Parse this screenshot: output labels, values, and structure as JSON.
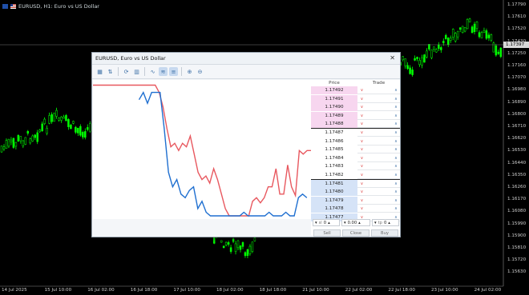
{
  "chart_window": {
    "title": "EURUSD, H1:  Euro vs US Dollar",
    "current_price": "1.17397",
    "price_axis": [
      "1.17790",
      "1.17610",
      "1.17520",
      "1.17430",
      "1.17250",
      "1.17160",
      "1.17070",
      "1.16980",
      "1.16890",
      "1.16800",
      "1.16710",
      "1.16620",
      "1.16530",
      "1.16440",
      "1.16350",
      "1.16260",
      "1.16170",
      "1.16080",
      "1.15990",
      "1.15900",
      "1.15810",
      "1.15720",
      "1.15630"
    ],
    "time_axis": [
      "14 Jul 2025",
      "15 Jul 10:00",
      "16 Jul 02:00",
      "16 Jul 18:00",
      "17 Jul 10:00",
      "18 Jul 02:00",
      "18 Jul 18:00",
      "21 Jul 10:00",
      "22 Jul 02:00",
      "22 Jul 18:00",
      "23 Jul 10:00",
      "24 Jul 02:00"
    ],
    "candle_color": "#00ff00",
    "background": "#000000"
  },
  "depth_dialog": {
    "title": "EURUSD, Euro vs US Dollar",
    "close_label": "✕",
    "toolbar": [
      {
        "icon": "chart-settings-icon",
        "glyph": "▦",
        "active": false
      },
      {
        "icon": "ladder-icon",
        "glyph": "⇅",
        "active": false
      },
      {
        "icon": "refresh-icon",
        "glyph": "⟳",
        "active": false
      },
      {
        "icon": "columns-icon",
        "glyph": "▥",
        "active": false
      },
      {
        "icon": "tick-chart-icon",
        "glyph": "∿",
        "active": false
      },
      {
        "icon": "depth-chart-icon",
        "glyph": "≋",
        "active": true
      },
      {
        "icon": "bars-icon",
        "glyph": "≡",
        "active": true
      },
      {
        "icon": "zoom-in-icon",
        "glyph": "⊕",
        "active": false
      },
      {
        "icon": "zoom-out-icon",
        "glyph": "⊖",
        "active": false
      }
    ],
    "headers": {
      "price": "Price",
      "trade": "Trade"
    },
    "rows": [
      {
        "price": "1.17492",
        "side": "ask"
      },
      {
        "price": "1.17491",
        "side": "ask"
      },
      {
        "price": "1.17490",
        "side": "ask"
      },
      {
        "price": "1.17489",
        "side": "ask"
      },
      {
        "price": "1.17488",
        "side": "ask"
      },
      {
        "price": "1.17487",
        "side": "mid"
      },
      {
        "price": "1.17486",
        "side": "mid"
      },
      {
        "price": "1.17485",
        "side": "mid"
      },
      {
        "price": "1.17484",
        "side": "mid"
      },
      {
        "price": "1.17483",
        "side": "mid"
      },
      {
        "price": "1.17482",
        "side": "mid"
      },
      {
        "price": "1.17481",
        "side": "bid"
      },
      {
        "price": "1.17480",
        "side": "bid"
      },
      {
        "price": "1.17479",
        "side": "bid"
      },
      {
        "price": "1.17478",
        "side": "bid"
      },
      {
        "price": "1.17477",
        "side": "bid"
      }
    ],
    "controls": {
      "sl_label": "sl",
      "sl_value": "0",
      "volume_value": "0.00",
      "tp_label": "tp",
      "tp_value": "0"
    },
    "actions": {
      "sell": "Sell",
      "close": "Close",
      "buy": "Buy"
    },
    "tick_chart": {
      "ask_color": "#e8585f",
      "bid_color": "#1f6fd0",
      "ask": [
        1.175,
        1.175,
        1.175,
        1.175,
        1.175,
        1.175,
        1.175,
        1.175,
        1.175,
        1.175,
        1.175,
        1.175,
        1.175,
        1.175,
        1.175,
        1.175,
        1.175,
        1.1749,
        1.1747,
        1.1744,
        1.17415,
        1.1742,
        1.1741,
        1.1742,
        1.17415,
        1.1743,
        1.17405,
        1.1738,
        1.1737,
        1.17375,
        1.17365,
        1.17385,
        1.1737,
        1.1735,
        1.1733,
        1.1732,
        1.1732,
        1.1732,
        1.1732,
        1.1732,
        1.1732,
        1.1734,
        1.17345,
        1.17338,
        1.17345,
        1.1736,
        1.1736,
        1.17385,
        1.1735,
        1.1735,
        1.1739,
        1.1736,
        1.17348,
        1.1741,
        1.17405,
        1.1741,
        1.1741
      ],
      "bid": [
        1.1748,
        1.1749,
        1.17475,
        1.1749,
        1.1749,
        1.1749,
        1.1744,
        1.1738,
        1.1736,
        1.1737,
        1.1735,
        1.17345,
        1.17355,
        1.1736,
        1.1733,
        1.1734,
        1.17325,
        1.1732,
        1.1732,
        1.1732,
        1.1732,
        1.1732,
        1.1732,
        1.1732,
        1.1732,
        1.17325,
        1.1732,
        1.1732,
        1.1732,
        1.1732,
        1.1732,
        1.17325,
        1.1732,
        1.1732,
        1.1732,
        1.17325,
        1.1732,
        1.1732,
        1.17345,
        1.1735,
        1.17345
      ]
    }
  }
}
